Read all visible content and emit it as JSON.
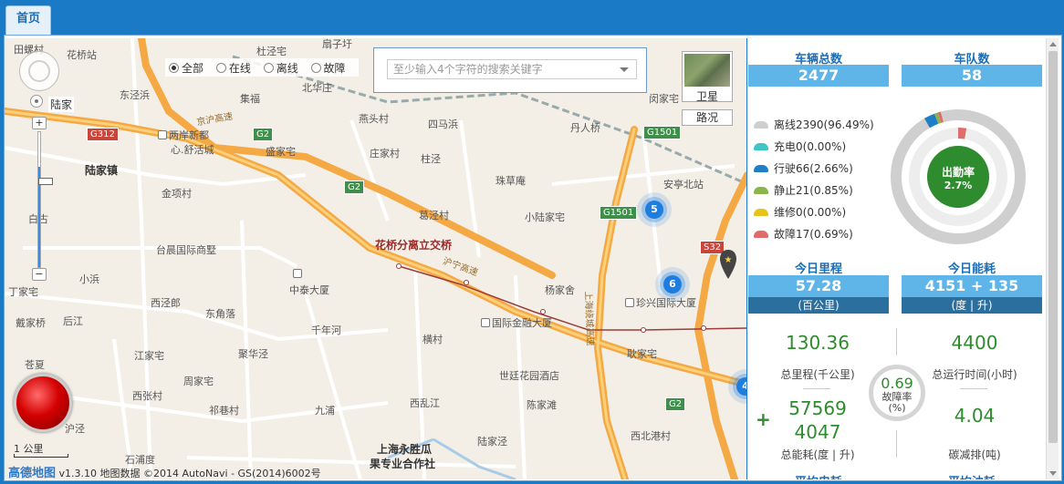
{
  "nav": {
    "home_tab": "首页"
  },
  "map": {
    "filters": [
      {
        "label": "全部",
        "checked": true
      },
      {
        "label": "在线",
        "checked": false
      },
      {
        "label": "离线",
        "checked": false
      },
      {
        "label": "故障",
        "checked": false
      }
    ],
    "search_placeholder": "至少输入4个字符的搜索关键字",
    "satellite_label": "卫星",
    "traffic_label": "路况",
    "scale_label": "1 公里",
    "attribution_logo": "高德地图",
    "attribution_text": "v1.3.10 地图数据 ©2014 AutoNavi - GS(2014)6002号",
    "clusters": [
      "5",
      "6",
      "4"
    ],
    "labels": {
      "l1": "田螺村",
      "l2": "花桥站",
      "l3": "杜泾宅",
      "l4": "扇子圩",
      "l5": "东泾浜",
      "l6": "陆家",
      "l7": "集福",
      "l8": "北华庄",
      "l9": "闵家宅",
      "l10": "燕头村",
      "l11": "四马浜",
      "l12": "两岸新都",
      "l13": "心.舒活城",
      "l14": "盛家宅",
      "l15": "庄家村",
      "l16": "柱泾",
      "l17": "丹人桥",
      "l18": "陆家镇",
      "l19": "金项村",
      "l20": "珠草庵",
      "l21": "安亭北站",
      "l22": "白古",
      "l23": "葛泾村",
      "l24": "小陆家宅",
      "l25": "台晨国际商墅",
      "l26": "花桥分离立交桥",
      "l27": "小浜",
      "l28": "中泰大厦",
      "l29": "杨家舍",
      "l30": "珍兴国际大厦",
      "l31": "西泾郎",
      "l32": "东角落",
      "l33": "戴家桥",
      "l34": "后江",
      "l35": "千年河",
      "l36": "国际金融大厦",
      "l37": "江家宅",
      "l38": "聚华泾",
      "l39": "横村",
      "l40": "耿家宅",
      "l41": "周家宅",
      "l42": "世廷花园酒店",
      "l43": "西张村",
      "l44": "祁巷村",
      "l45": "九浦",
      "l46": "西乱江",
      "l47": "陈家滩",
      "l48": "西北港村",
      "l49": "石浦度",
      "l50": "上海永胜瓜",
      "l51": "果专业合作社",
      "l52": "陆家泾",
      "l53": "丁家宅",
      "l54": "苍夏",
      "l55": "沪泾",
      "l56": "沪宁高速",
      "l57": "京沪高速",
      "l58": "上海绕城高速"
    },
    "shields": {
      "s1": "G312",
      "s2": "G2",
      "s3": "G2",
      "s4": "G1501",
      "s5": "G1501",
      "s6": "S32",
      "s7": "G2"
    }
  },
  "stats": {
    "vehicles_title": "车辆总数",
    "vehicles_value": "2477",
    "teams_title": "车队数",
    "teams_value": "58",
    "status_legend": [
      {
        "label": "离线2390(96.49%)",
        "color": "#cfcfcf"
      },
      {
        "label": "充电0(0.00%)",
        "color": "#3ec6c6"
      },
      {
        "label": "行驶66(2.66%)",
        "color": "#1f7fc6"
      },
      {
        "label": "静止21(0.85%)",
        "color": "#8bb44a"
      },
      {
        "label": "维修0(0.00%)",
        "color": "#e5c51a"
      },
      {
        "label": "故障17(0.69%)",
        "color": "#e06b6b"
      }
    ],
    "attendance_label": "出勤率",
    "attendance_value": "2.7%",
    "mileage_title": "今日里程",
    "mileage_value": "57.28",
    "mileage_unit": "(百公里)",
    "energy_title": "今日能耗",
    "energy_value": "4151 + 135",
    "energy_unit": "(度 | 升)",
    "total_mileage_value": "130.36",
    "total_mileage_label": "总里程(千公里)",
    "runtime_value": "4400",
    "runtime_label": "总运行时间(小时)",
    "fault_rate_value": "0.69",
    "fault_rate_label1": "故障率",
    "fault_rate_label2": "(%)",
    "total_energy_value1": "57569",
    "total_energy_value2": "4047",
    "total_energy_label": "总能耗(度 | 升)",
    "carbon_value": "4.04",
    "carbon_label": "碳减排(吨)",
    "avg_power_title": "平均电耗",
    "avg_fuel_title": "平均油耗"
  }
}
